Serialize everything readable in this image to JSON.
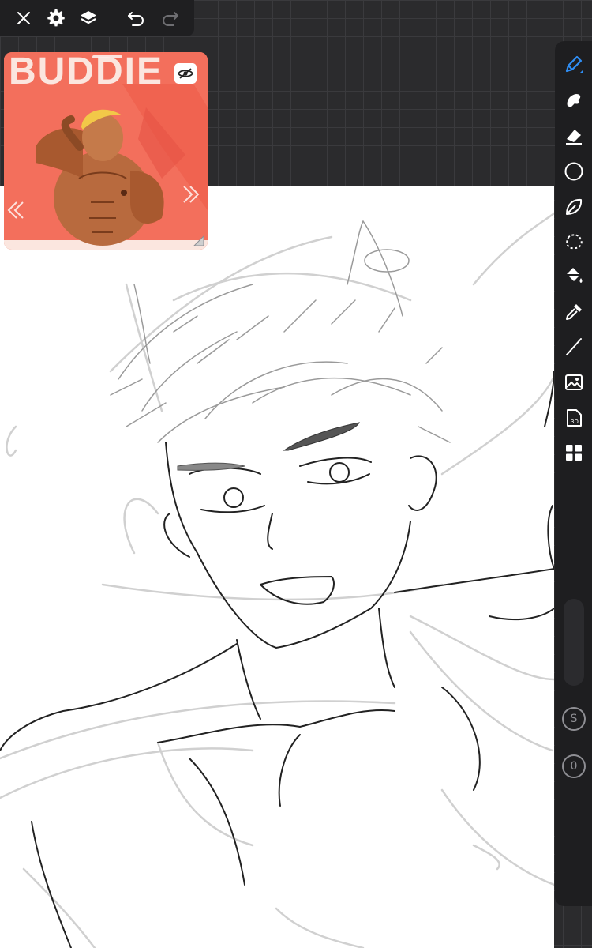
{
  "colors": {
    "toolbar_bg": "#1f1f21",
    "grid_bg": "#2b2b2d",
    "accent": "#2f8ef5",
    "icon": "#ffffff",
    "reference_bg": "#f36f5c"
  },
  "top_toolbar": {
    "close": "close-icon",
    "settings": "gear-icon",
    "layers": "layers-icon",
    "undo": "undo-icon",
    "redo": "redo-icon"
  },
  "reference_window": {
    "title_text": "BUDDIE",
    "eye_icon": "eye-hidden-icon"
  },
  "right_toolbar": {
    "tools": [
      "brush-icon",
      "smudge-icon",
      "eraser-icon",
      "shape-icon",
      "lasso-icon",
      "selection-icon",
      "fill-icon",
      "eyedropper-icon",
      "line-icon",
      "image-import-icon",
      "3d-file-icon",
      "grid-layout-icon"
    ],
    "brush_size_label": "S",
    "opacity_label": "0"
  }
}
